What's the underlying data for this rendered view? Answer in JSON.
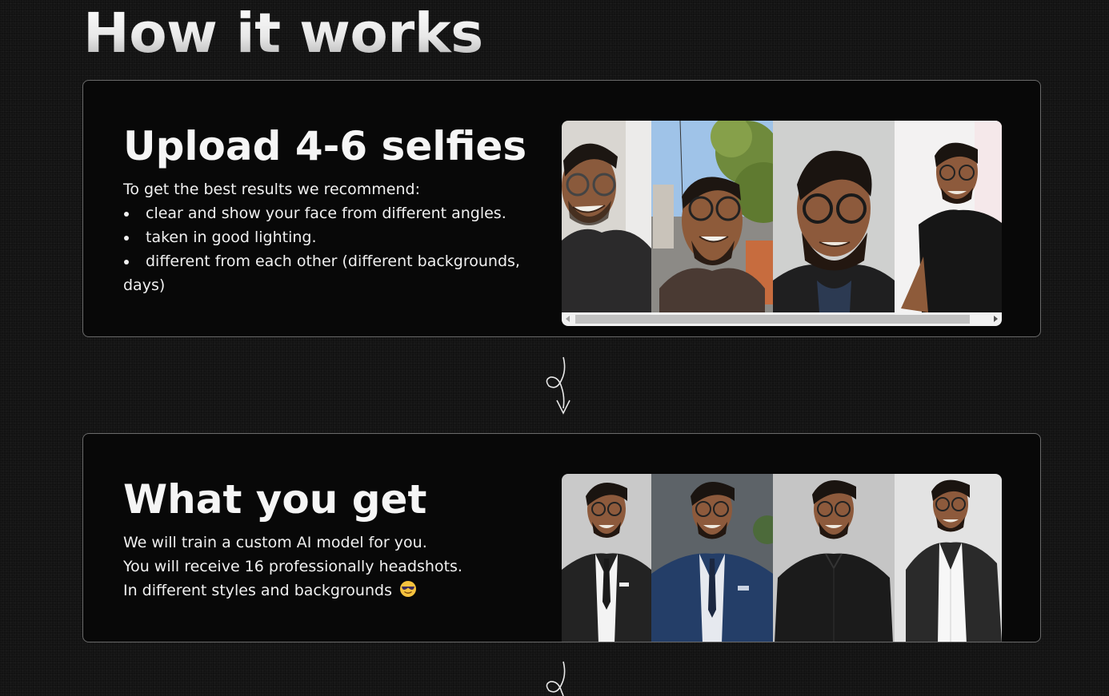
{
  "page": {
    "heading": "How it works"
  },
  "step_upload": {
    "title": "Upload 4-6 selfies",
    "intro": "To get the best results we recommend:",
    "tips": [
      "clear and show your face from different angles.",
      "taken in good lighting.",
      "different from each other (different backgrounds, days)"
    ],
    "gallery_alt": "Example selfies"
  },
  "step_result": {
    "title": "What you get",
    "lines": [
      "We will train a custom AI model for you.",
      "You will receive 16 professionally headshots.",
      "In different styles and backgrounds"
    ],
    "emoji": "sunglasses-face",
    "gallery_alt": "Example headshots"
  },
  "colors": {
    "page_bg": "#121212",
    "card_bg": "#080808",
    "card_border": "#6a6a6a",
    "text": "#f0f0f0"
  }
}
